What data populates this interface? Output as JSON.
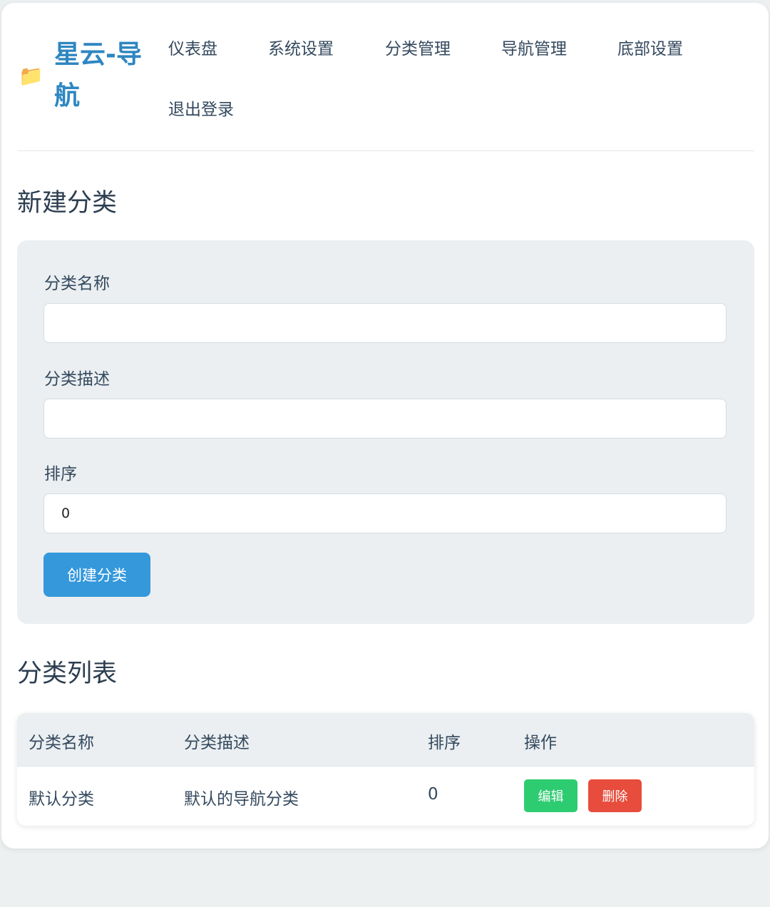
{
  "brand": {
    "icon": "folder-icon",
    "title": "星云-导航"
  },
  "nav": {
    "items": [
      "仪表盘",
      "系统设置",
      "分类管理",
      "导航管理",
      "底部设置",
      "退出登录"
    ]
  },
  "new_category": {
    "heading": "新建分类",
    "name_label": "分类名称",
    "name_value": "",
    "desc_label": "分类描述",
    "desc_value": "",
    "sort_label": "排序",
    "sort_value": "0",
    "submit_label": "创建分类"
  },
  "category_list": {
    "heading": "分类列表",
    "columns": [
      "分类名称",
      "分类描述",
      "排序",
      "操作"
    ],
    "rows": [
      {
        "name": "默认分类",
        "description": "默认的导航分类",
        "sort": "0",
        "edit_label": "编辑",
        "delete_label": "删除"
      }
    ]
  },
  "colors": {
    "brand": "#2e86c1",
    "primary": "#3498db",
    "success": "#2ecc71",
    "danger": "#e74c3c",
    "panel": "#ebeff1"
  }
}
